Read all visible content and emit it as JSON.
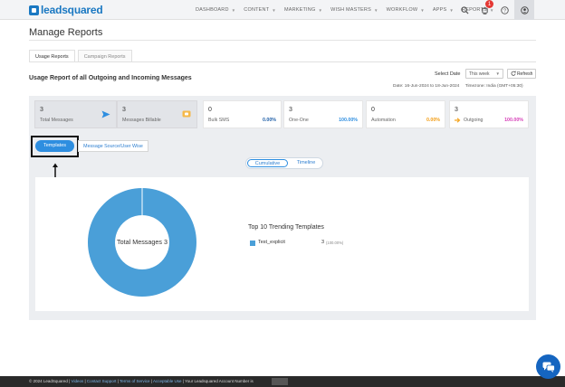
{
  "header": {
    "logo": "leadsquared",
    "nav": [
      "DASHBOARD",
      "CONTENT",
      "MARKETING",
      "WISH MASTERS",
      "WORKFLOW",
      "APPS",
      "REPORTS"
    ],
    "notification_count": "1",
    "icons": [
      "search-icon",
      "notification-icon",
      "help-icon",
      "user-icon"
    ]
  },
  "page": {
    "title": "Manage Reports",
    "tabs": [
      {
        "label": "Usage Reports",
        "active": true
      },
      {
        "label": "Campaign Reports",
        "active": false
      }
    ],
    "report_title": "Usage Report of all Outgoing and Incoming Messages",
    "select_date_label": "Select Date",
    "select_date_value": "This week",
    "refresh_label": "Refresh",
    "date_range": "Date: 16-Jun-2024 to 18-Jun-2024",
    "timezone": "Timezone: India (GMT+05:30)"
  },
  "stats": [
    {
      "value": "3",
      "label": "Total Messages",
      "icon": "send-icon"
    },
    {
      "value": "3",
      "label": "Messages Billable",
      "icon": "billing-icon"
    },
    {
      "value": "0",
      "label": "Bulk SMS",
      "percent": "0.00%",
      "color": "#1f5fa8"
    },
    {
      "value": "3",
      "label": "One-One",
      "percent": "100.00%",
      "color": "#2e8ee0"
    },
    {
      "value": "0",
      "label": "Automation",
      "percent": "0.00%",
      "color": "#f39c12"
    },
    {
      "value": "3",
      "label": "Outgoing",
      "percent": "100.00%",
      "color": "#d63fb8",
      "icon": "outgoing-arrow-icon"
    }
  ],
  "subtabs": {
    "templates": "Templates",
    "source": "Message Source/User Wise"
  },
  "view_toggle": {
    "cumulative": "Cumulative",
    "timeline": "Timeline",
    "selected": "Cumulative"
  },
  "chart_data": {
    "type": "pie",
    "center_label": "Total Messages 3",
    "title": "Top 10 Trending Templates",
    "slices": [
      {
        "name": "Test_explicit",
        "value": 3,
        "percent_label": "(100.00%)",
        "color": "#4a9fd8"
      }
    ]
  },
  "footer": {
    "copyright": "© 2024 LeadSquared |",
    "links": [
      "Videos",
      "Contact Support",
      "Terms of Service",
      "Acceptable Use"
    ],
    "account_text": "| Your Leadsquared Account Number is"
  },
  "colors": {
    "accent": "#2e8ee0",
    "brand": "#1a78c2",
    "donut": "#4a9fd8"
  }
}
